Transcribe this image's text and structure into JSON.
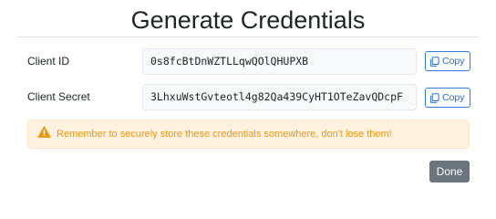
{
  "dialog": {
    "title": "Generate Credentials"
  },
  "fields": [
    {
      "label": "Client ID",
      "value": "0s8fcBtDnWZTLLqwQOlQHUPXB",
      "copy_label": "Copy"
    },
    {
      "label": "Client Secret",
      "value": "3LhxuWstGvteotl4g82Qa439CyHT1OTeZavQDcpF",
      "copy_label": "Copy"
    }
  ],
  "alert": {
    "icon": "warning-triangle-icon",
    "text": "Remember to securely store these credentials somewhere, don't lose them!"
  },
  "footer": {
    "done_label": "Done"
  },
  "colors": {
    "accent": "#2f7fe0",
    "warning_text": "#f0960a",
    "warning_bg": "#fff3e0",
    "secondary_button": "#6c757d"
  }
}
